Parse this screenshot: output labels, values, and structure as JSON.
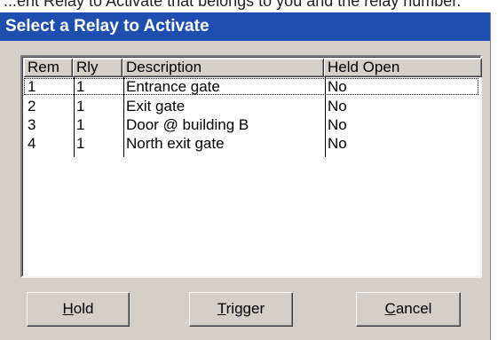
{
  "background_text": "...ent Relay to Activate that belongs to you and the relay number.",
  "dialog": {
    "title": "Select a Relay to Activate",
    "title_color": "#1e4fb0"
  },
  "table": {
    "columns": [
      "Rem",
      "Rly",
      "Description",
      "Held Open"
    ],
    "rows": [
      {
        "rem": "1",
        "rly": "1",
        "description": "Entrance gate",
        "held_open": "No"
      },
      {
        "rem": "2",
        "rly": "1",
        "description": "Exit gate",
        "held_open": "No"
      },
      {
        "rem": "3",
        "rly": "1",
        "description": "Door @ building B",
        "held_open": "No"
      },
      {
        "rem": "4",
        "rly": "1",
        "description": "North exit gate",
        "held_open": "No"
      }
    ]
  },
  "buttons": {
    "hold": {
      "label": "Hold",
      "mnemonic": "H",
      "rest": "old"
    },
    "trigger": {
      "label": "Trigger",
      "mnemonic": "T",
      "rest": "rigger"
    },
    "cancel": {
      "label": "Cancel",
      "mnemonic": "C",
      "rest": "ancel"
    }
  }
}
